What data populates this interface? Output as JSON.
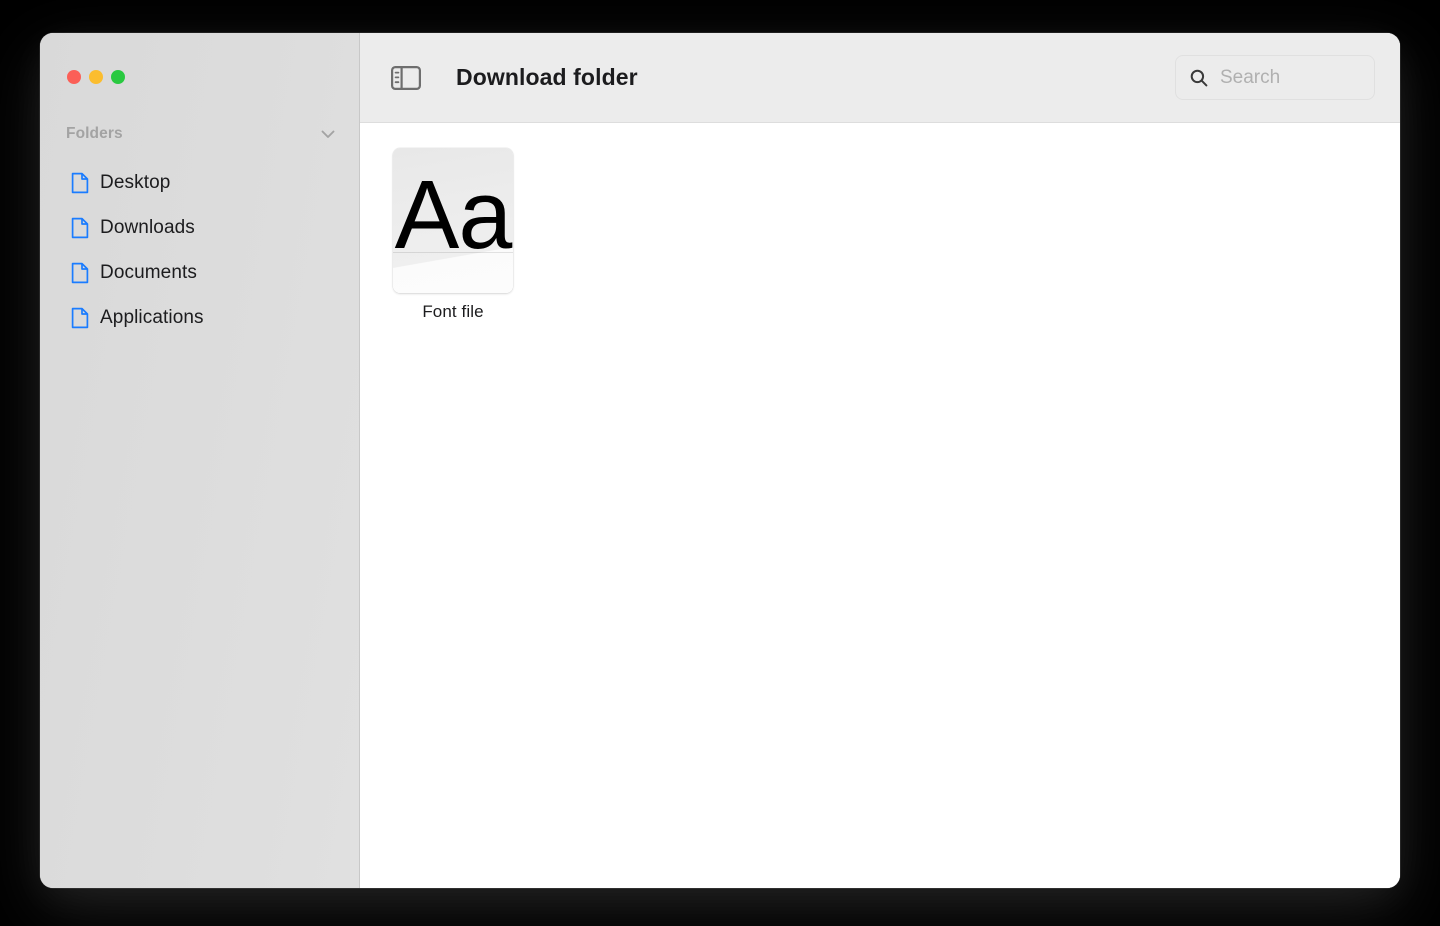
{
  "window": {
    "traffic_lights": [
      {
        "name": "close",
        "color": "#fb5f57"
      },
      {
        "name": "minimize",
        "color": "#fbbd2e"
      },
      {
        "name": "zoom",
        "color": "#29c940"
      }
    ]
  },
  "sidebar": {
    "section_title": "Folders",
    "collapse_icon": "chevron-down-icon",
    "icon_color": "#1a7cff",
    "items": [
      {
        "label": "Desktop",
        "icon": "document-icon"
      },
      {
        "label": "Downloads",
        "icon": "document-icon"
      },
      {
        "label": "Documents",
        "icon": "document-icon"
      },
      {
        "label": "Applications",
        "icon": "document-icon"
      }
    ]
  },
  "toolbar": {
    "sidebar_toggle_icon": "sidebar-toggle-icon",
    "title": "Download folder",
    "search": {
      "icon": "search-icon",
      "value": "",
      "placeholder": "Search"
    }
  },
  "content": {
    "files": [
      {
        "label": "Font file",
        "icon": "font-file-icon",
        "glyph": "Aa"
      }
    ]
  }
}
